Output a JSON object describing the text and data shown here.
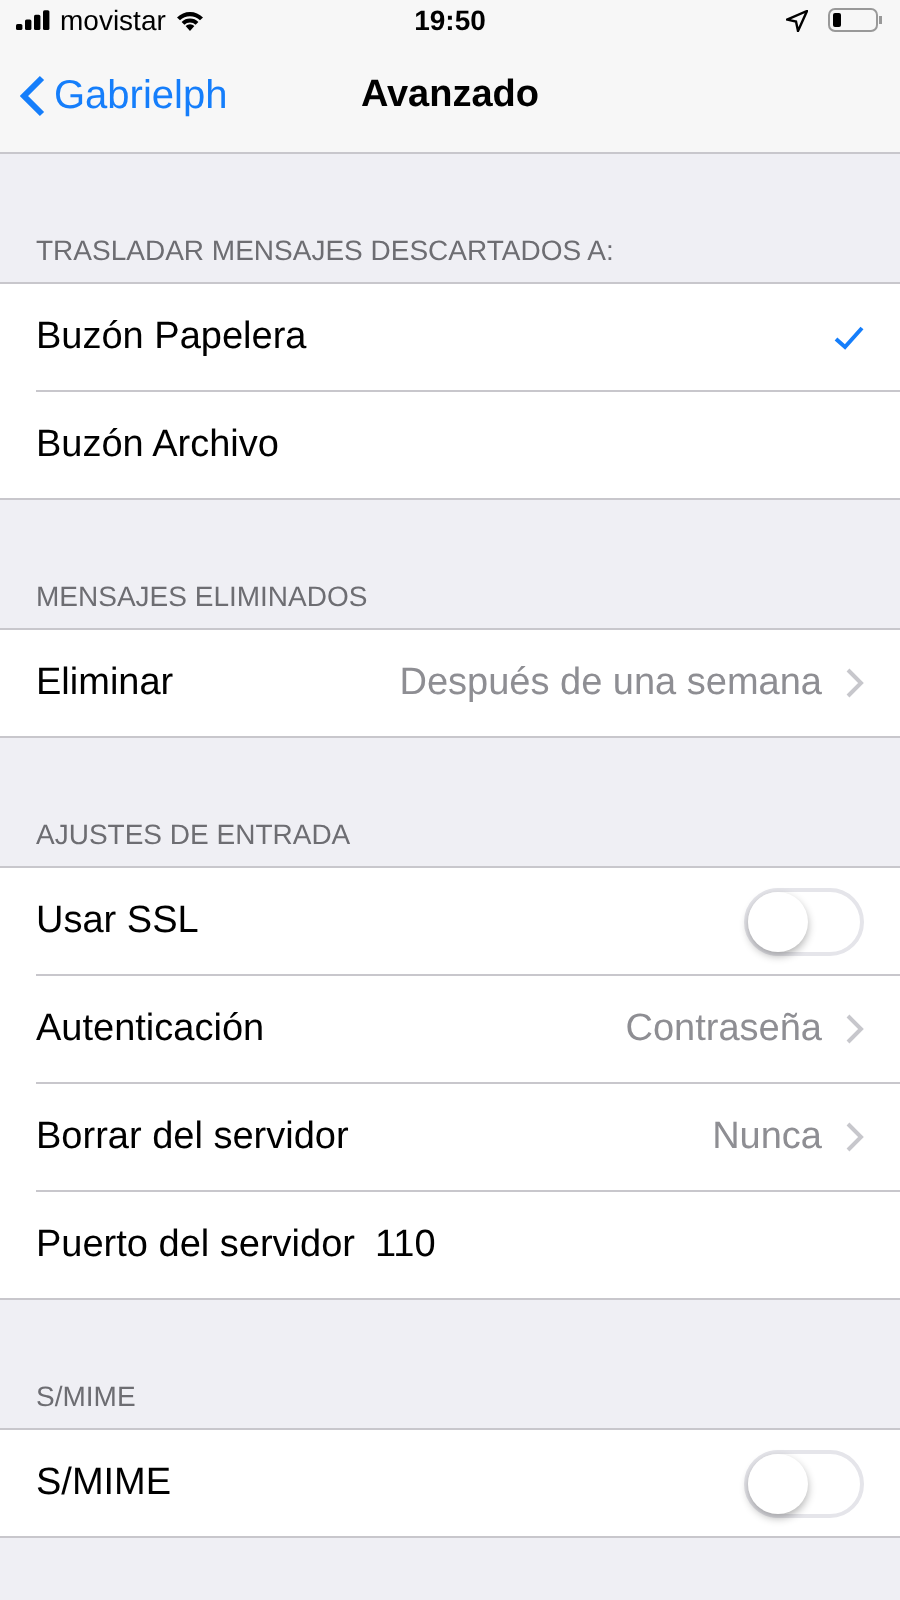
{
  "status_bar": {
    "carrier": "movistar",
    "time": "19:50"
  },
  "nav": {
    "back": "Gabrielph",
    "title": "Avanzado"
  },
  "sections": [
    {
      "header": "TRASLADAR MENSAJES DESCARTADOS A:",
      "rows": [
        {
          "kind": "check",
          "label": "Buzón Papelera",
          "selected": true
        },
        {
          "kind": "check",
          "label": "Buzón Archivo",
          "selected": false
        }
      ]
    },
    {
      "header": "MENSAJES ELIMINADOS",
      "rows": [
        {
          "kind": "disclosure",
          "label": "Eliminar",
          "value": "Después de una semana"
        }
      ]
    },
    {
      "header": "AJUSTES DE ENTRADA",
      "rows": [
        {
          "kind": "toggle",
          "label": "Usar SSL",
          "on": false
        },
        {
          "kind": "disclosure",
          "label": "Autenticación",
          "value": "Contraseña"
        },
        {
          "kind": "disclosure",
          "label": "Borrar del servidor",
          "value": "Nunca"
        },
        {
          "kind": "field",
          "label": "Puerto del servidor",
          "value": "110"
        }
      ]
    },
    {
      "header": "S/MIME",
      "rows": [
        {
          "kind": "toggle",
          "label": "S/MIME",
          "on": false
        }
      ]
    }
  ]
}
